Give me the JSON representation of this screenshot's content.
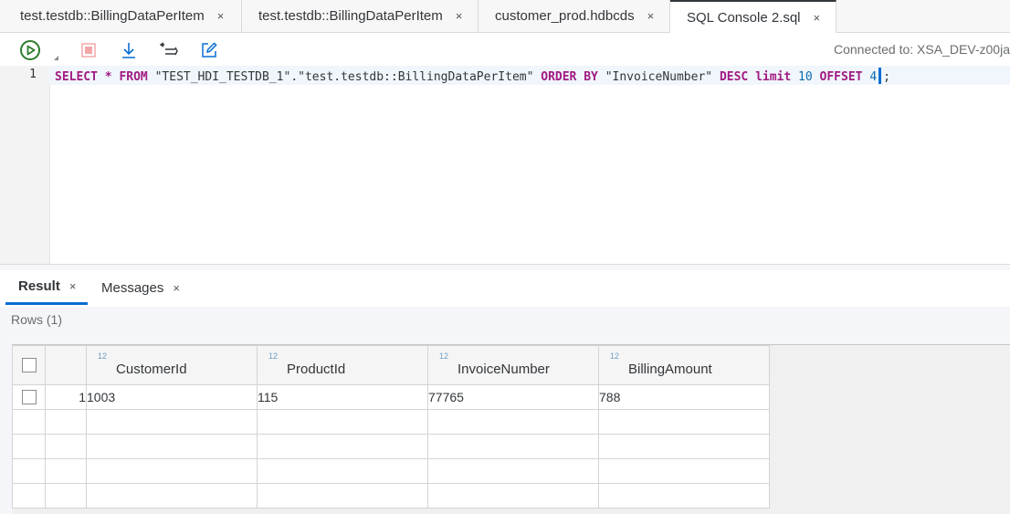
{
  "tabs": [
    {
      "label": "test.testdb::BillingDataPerItem",
      "close": "×"
    },
    {
      "label": "test.testdb::BillingDataPerItem",
      "close": "×"
    },
    {
      "label": "customer_prod.hdbcds",
      "close": "×"
    },
    {
      "label": "SQL Console 2.sql",
      "close": "×"
    }
  ],
  "toolbar": {
    "icons": [
      "run-icon",
      "stop-icon",
      "download-icon",
      "format-icon",
      "edit-icon"
    ],
    "connected": "Connected to: XSA_DEV-z00ja"
  },
  "editor": {
    "line_number": "1",
    "tokens": {
      "select": "SELECT",
      "star": "*",
      "from": "FROM",
      "schema": "\"TEST_HDI_TESTDB_1\"",
      "dot": ".",
      "table": "\"test.testdb::BillingDataPerItem\"",
      "order": "ORDER",
      "by": "BY",
      "column": "\"InvoiceNumber\"",
      "desc": "DESC",
      "limit": "limit",
      "limit_value": "10",
      "offset": "OFFSET",
      "offset_value": "4",
      "semicolon": ";"
    }
  },
  "result_tabs": [
    {
      "label": "Result",
      "close": "×"
    },
    {
      "label": "Messages",
      "close": "×"
    }
  ],
  "rows_label": "Rows (1)",
  "grid": {
    "columns": [
      {
        "type": "12",
        "name": "CustomerId"
      },
      {
        "type": "12",
        "name": "ProductId"
      },
      {
        "type": "12",
        "name": "InvoiceNumber"
      },
      {
        "type": "12",
        "name": "BillingAmount"
      }
    ],
    "rows": [
      {
        "num": "1",
        "cells": [
          "1003",
          "115",
          "77765",
          "788"
        ]
      }
    ]
  },
  "colors": {
    "accent": "#0a6ed1",
    "run": "#2b7c2b",
    "keyword": "#a11a82"
  }
}
